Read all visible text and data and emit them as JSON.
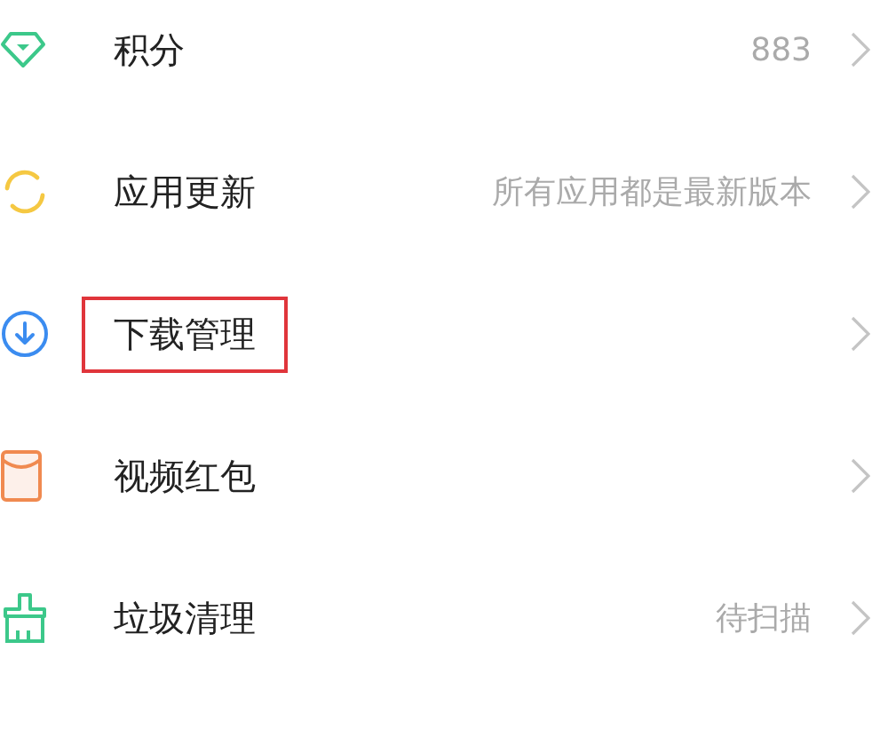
{
  "items": [
    {
      "kind": "points",
      "label": "积分",
      "value": "883",
      "highlighted": false
    },
    {
      "kind": "update",
      "label": "应用更新",
      "value": "所有应用都是最新版本",
      "highlighted": false
    },
    {
      "kind": "download",
      "label": "下载管理",
      "highlighted": true
    },
    {
      "kind": "redpacket",
      "label": "视频红包",
      "highlighted": false
    },
    {
      "kind": "clean",
      "label": "垃圾清理",
      "value": "待扫描",
      "highlighted": false
    }
  ]
}
